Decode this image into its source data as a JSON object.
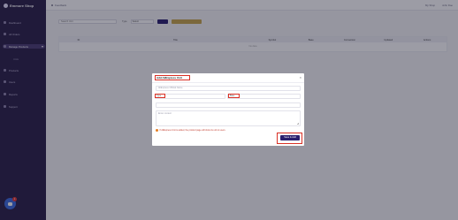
{
  "app": {
    "name": "Emmore Shop"
  },
  "topbar": {
    "breadcrumb": "Feedback",
    "right_link_1": "My Shop",
    "right_link_2": "John Doe"
  },
  "sidebar": {
    "items": [
      {
        "label": "Dashboard"
      },
      {
        "label": "All Orders"
      },
      {
        "label": "Manage Products"
      },
      {
        "label": "Products"
      },
      {
        "label": "Users"
      },
      {
        "label": "Reports"
      },
      {
        "label": "Support"
      }
    ],
    "sub_item": "Units",
    "chat_badge": "1"
  },
  "filters": {
    "search_placeholder": "Search Unit",
    "type_label": "Type",
    "type_value": "Select"
  },
  "table": {
    "headers": [
      "ID",
      "Title",
      "Symbol",
      "Base",
      "Conversion",
      "Updated",
      "Actions"
    ],
    "empty_text": "No data"
  },
  "modal": {
    "title": "Add AliExpress Unit",
    "name_placeholder": "AliExpress Official Name",
    "left_field_tag": "Type",
    "right_field_tag": "Base",
    "notes_placeholder": "Enter content",
    "warning": "If AliExpress Unit is added, the product page will show its unit to users.",
    "save_label": "Save & Add"
  },
  "colors": {
    "sidebar": "#2a1f47",
    "primary": "#2a1f6e",
    "highlight": "#d93025",
    "accent": "#c7a54a"
  }
}
